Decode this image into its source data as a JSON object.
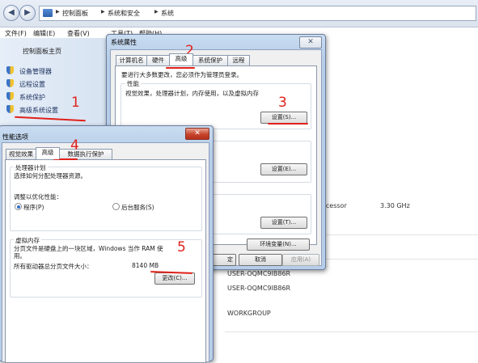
{
  "explorer": {
    "breadcrumbs": [
      "控制面板",
      "系统和安全",
      "系统"
    ],
    "menu": [
      "文件(F)",
      "编辑(E)",
      "查看(V)",
      "工具(T)",
      "帮助(H)"
    ],
    "left_pane": {
      "home": "控制面板主页",
      "items": [
        "设备管理器",
        "远程设置",
        "系统保护",
        "高级系统设置"
      ]
    },
    "details": {
      "processor_suffix": "ocessor",
      "processor_speed": "3.30 GHz",
      "computer_name": "USER-OQMC9IB86R",
      "full_computer_name": "USER-OQMC9IB86R",
      "workgroup": "WORKGROUP"
    }
  },
  "system_properties": {
    "title": "系统属性",
    "close": "✕",
    "tabs": [
      "计算机名",
      "硬件",
      "高级",
      "系统保护",
      "远程"
    ],
    "admin_note": "要进行大多数更改，您必须作为管理员登录。",
    "performance_label": "性能",
    "performance_desc": "视觉效果，处理器计划，内存使用，以及虚拟内存",
    "settings_perf": "设置(S)...",
    "settings_profile": "设置(E)...",
    "settings_startup": "设置(T)...",
    "env_vars": "环境变量(N)...",
    "ok_partial": "定",
    "cancel": "取消",
    "apply": "应用(A)"
  },
  "performance_options": {
    "title": "性能选项",
    "close": "✕",
    "tabs": [
      "视觉效果",
      "高级",
      "数据执行保护"
    ],
    "cpu_group_label": "处理器计划",
    "cpu_desc": "选择如何分配处理器资源。",
    "adjust_label": "调整以优化性能：",
    "options": [
      "程序(P)",
      "后台服务(S)"
    ],
    "selected_option": "程序(P)",
    "vm_group_label": "虚拟内存",
    "vm_desc_line1": "分页文件是硬盘上的一块区域，Windows 当作 RAM 使",
    "vm_desc_line2": "用。",
    "vm_total_label": "所有驱动器总分页文件大小：",
    "vm_total_value": "8140 MB",
    "change_button": "更改(C)..."
  },
  "annotations": [
    "1",
    "2",
    "3",
    "4",
    "5"
  ],
  "colors": {
    "annotation": "#e0211b",
    "link": "#1c2f5e",
    "dialog_frame": "#b7cde8"
  }
}
